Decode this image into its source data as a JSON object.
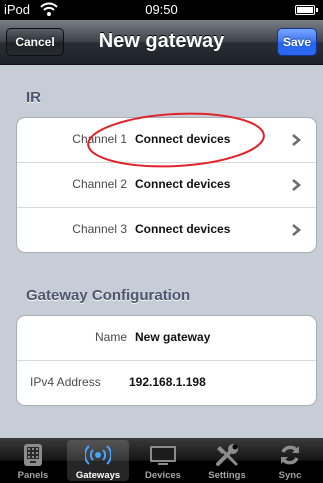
{
  "status": {
    "carrier": "iPod",
    "time": "09:50"
  },
  "nav": {
    "title": "New gateway",
    "cancel_label": "Cancel",
    "save_label": "Save"
  },
  "sections": {
    "ir": {
      "header": "IR",
      "rows": [
        {
          "label": "Channel 1",
          "value": "Connect devices"
        },
        {
          "label": "Channel 2",
          "value": "Connect devices"
        },
        {
          "label": "Channel 3",
          "value": "Connect devices"
        }
      ]
    },
    "gateway": {
      "header": "Gateway Configuration",
      "name_label": "Name",
      "name_value": "New gateway",
      "ip_label": "IPv4 Address",
      "ip_value": "192.168.1.198"
    }
  },
  "tabs": [
    {
      "label": "Panels",
      "icon": "panels-icon"
    },
    {
      "label": "Gateways",
      "icon": "gateway-icon",
      "active": true
    },
    {
      "label": "Devices",
      "icon": "devices-icon"
    },
    {
      "label": "Settings",
      "icon": "settings-icon"
    },
    {
      "label": "Sync",
      "icon": "sync-icon"
    }
  ],
  "colors": {
    "annotation": "#e0242c",
    "save_button": "#2b69f0",
    "section_header": "#4c566c"
  }
}
